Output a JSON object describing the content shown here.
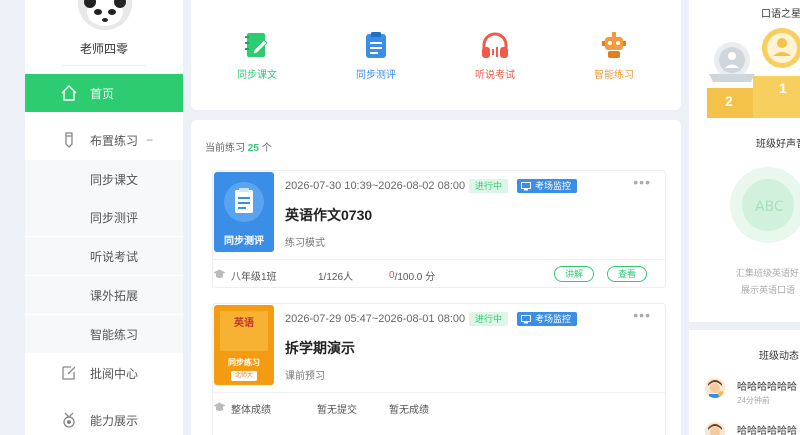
{
  "user": {
    "name": "老师四零"
  },
  "nav": {
    "home": "首页",
    "assign": "布置练习",
    "assign_toggle": "−",
    "sub": [
      "同步课文",
      "同步测评",
      "听说考试",
      "课外拓展",
      "智能练习"
    ],
    "review": "批阅中心",
    "ability": "能力展示"
  },
  "features": [
    {
      "label": "同步课文",
      "icon": "book-pen-icon",
      "color": "#2ecc71"
    },
    {
      "label": "同步测评",
      "icon": "clipboard-icon",
      "color": "#3a8ee6"
    },
    {
      "label": "听说考试",
      "icon": "headphones-icon",
      "color": "#f05a4a"
    },
    {
      "label": "智能练习",
      "icon": "robot-icon",
      "color": "#f39c3d"
    }
  ],
  "list": {
    "count_prefix": "当前练习",
    "count": "25",
    "count_suffix": "个",
    "cards": [
      {
        "thumb_label": "同步测评",
        "time": "2026-07-30 10:39~2026-08-02 08:00",
        "status": "进行中",
        "monitor": "考场监控",
        "more": "•••",
        "title": "英语作文0730",
        "mode": "练习模式",
        "class": "八年级1班",
        "submitted": "1/126人",
        "score_num": "0",
        "score_rest": "/100.0 分",
        "btn_explain": "讲解",
        "btn_view": "查看"
      },
      {
        "thumb_title": "英语",
        "thumb_sub": "同步练习",
        "thumb_tag": "北师大",
        "time": "2026-07-29 05:47~2026-08-01 08:00",
        "status": "进行中",
        "monitor": "考场监控",
        "more": "•••",
        "title": "拆学期演示",
        "mode": "课前预习",
        "overall": "整体成绩",
        "no_submit": "暂无提交",
        "no_score": "暂无成绩"
      }
    ]
  },
  "right": {
    "star_title": "口语之星",
    "rank2": "2",
    "rank1": "1",
    "voice_title": "班级好声音",
    "voice_desc1": "汇集班级英语好",
    "voice_desc2": "展示英语口语",
    "dynamic_title": "班级动态",
    "dynamics": [
      {
        "text": "哈哈哈哈哈哈",
        "time": "24分钟前"
      },
      {
        "text": "哈哈哈哈哈哈"
      }
    ]
  },
  "colors": {
    "accent": "#2ecc71",
    "blue": "#3a8ee6",
    "red": "#e74c3c"
  }
}
